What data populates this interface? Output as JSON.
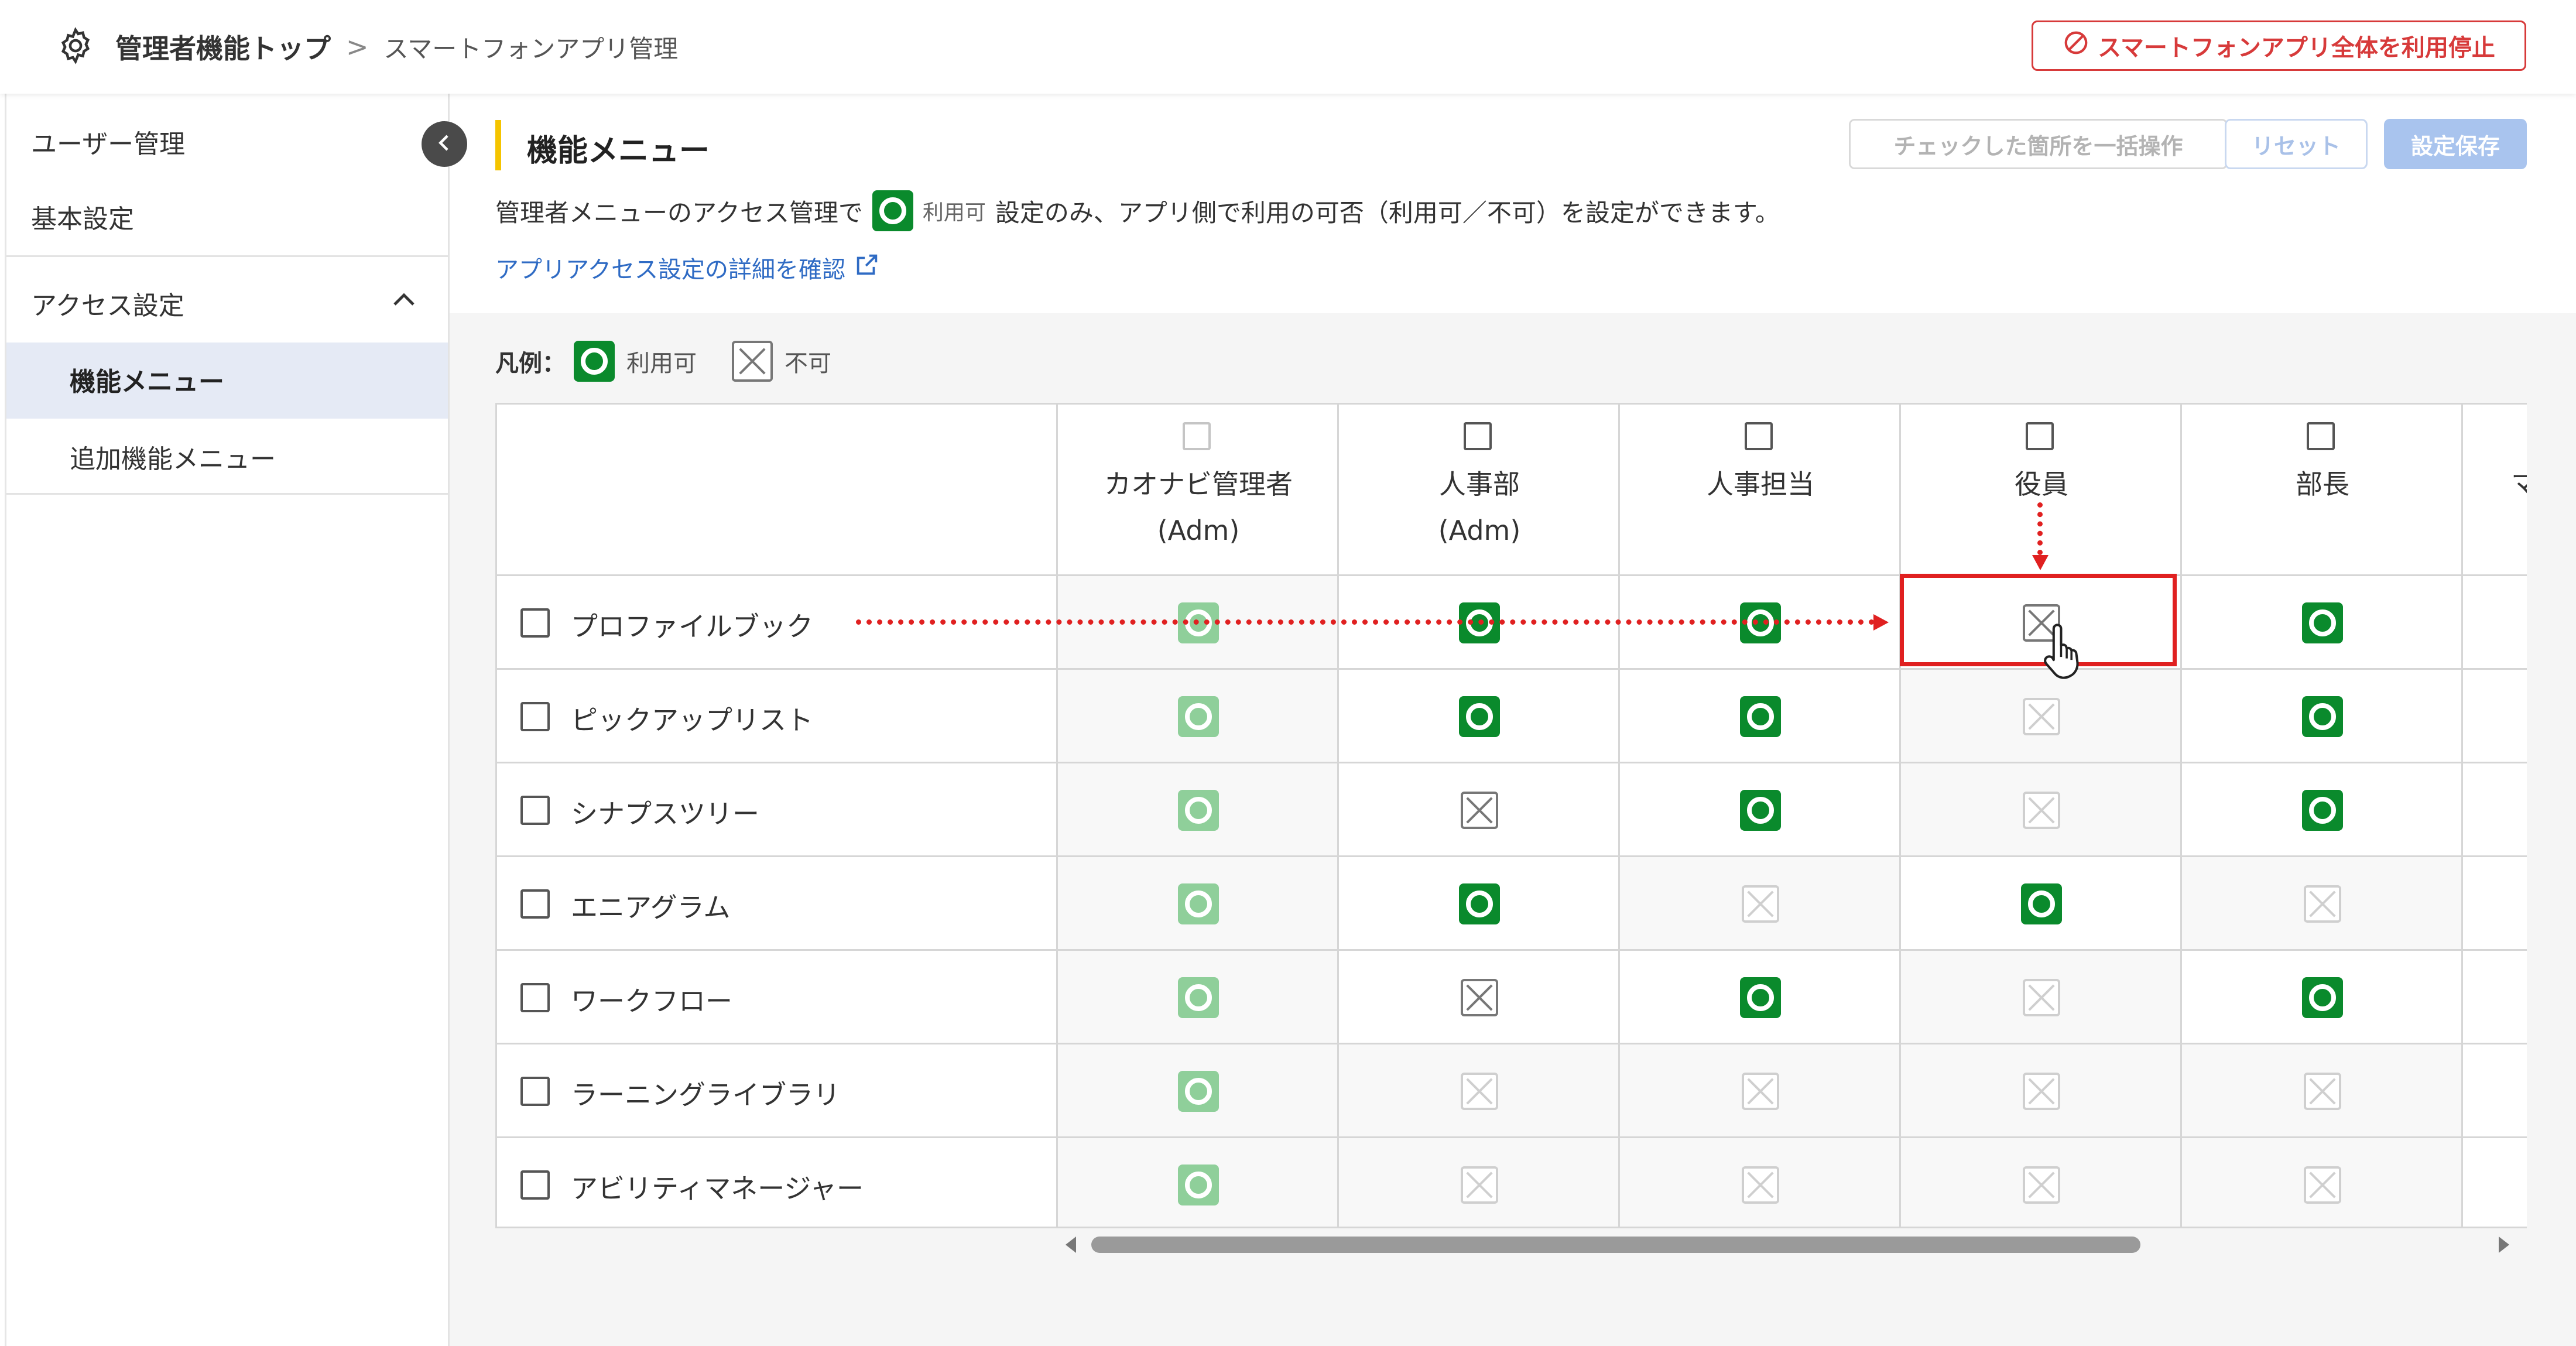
{
  "header": {
    "top_label": "管理者機能トップ",
    "separator": ">",
    "current_label": "スマートフォンアプリ管理",
    "stop_button": "スマートフォンアプリ全体を利用停止"
  },
  "sidebar": {
    "items": [
      {
        "label": "ユーザー管理"
      },
      {
        "label": "基本設定"
      },
      {
        "label": "アクセス設定"
      },
      {
        "label": "機能メニュー"
      },
      {
        "label": "追加機能メニュー"
      }
    ]
  },
  "main": {
    "title": "機能メニュー",
    "bulk_button": "チェックした箇所を一括操作",
    "reset_button": "リセット",
    "save_button": "設定保存",
    "description_before": "管理者メニューのアクセス管理で",
    "description_tag": "利用可",
    "description_after": "設定のみ、アプリ側で利用の可否（利用可／不可）を設定ができます。",
    "link_text": "アプリアクセス設定の詳細を確認",
    "legend": {
      "label": "凡例：",
      "available": "利用可",
      "unavailable": "不可"
    }
  },
  "table": {
    "columns": [
      {
        "name": "カオナビ管理者",
        "sub": "(Adm)"
      },
      {
        "name": "人事部",
        "sub": "(Adm)"
      },
      {
        "name": "人事担当",
        "sub": ""
      },
      {
        "name": "役員",
        "sub": ""
      },
      {
        "name": "部長",
        "sub": ""
      }
    ],
    "partial_column_glyph": "マ",
    "rows": [
      {
        "label": "プロファイルブック"
      },
      {
        "label": "ピックアップリスト"
      },
      {
        "label": "シナプスツリー"
      },
      {
        "label": "エニアグラム"
      },
      {
        "label": "ワークフロー"
      },
      {
        "label": "ラーニングライブラリ"
      },
      {
        "label": "アビリティマネージャー"
      }
    ],
    "status_matrix": [
      [
        "ok-dim",
        "ok",
        "ok",
        "ng",
        "ok"
      ],
      [
        "ok-dim",
        "ok",
        "ok",
        "ng-dim",
        "ok"
      ],
      [
        "ok-dim",
        "ng",
        "ok",
        "ng-dim",
        "ok"
      ],
      [
        "ok-dim",
        "ok",
        "ng-dim",
        "ok",
        "ng-dim"
      ],
      [
        "ok-dim",
        "ng",
        "ok",
        "ng-dim",
        "ok"
      ],
      [
        "ok-dim",
        "ng-dim",
        "ng-dim",
        "ng-dim",
        "ng-dim"
      ],
      [
        "ok-dim",
        "ng-dim",
        "ng-dim",
        "ng-dim",
        "ng-dim"
      ]
    ]
  },
  "colors": {
    "accent_red": "#d73a3a",
    "available_green": "#0a8a2c",
    "title_bar_yellow": "#f5c400",
    "link_blue": "#2f6bc4"
  }
}
